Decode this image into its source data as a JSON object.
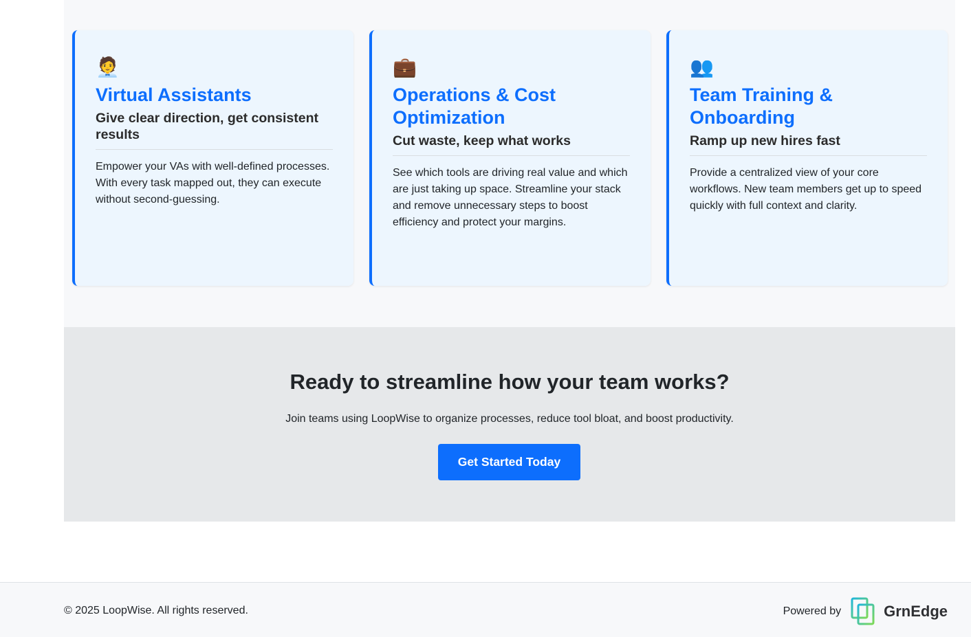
{
  "cards": [
    {
      "icon": "🧑‍💼",
      "title": "Virtual Assistants",
      "subtitle": "Give clear direction, get consistent results",
      "body": "Empower your VAs with well-defined processes. With every task mapped out, they can execute without second-guessing."
    },
    {
      "icon": "💼",
      "title": "Operations & Cost Optimization",
      "subtitle": "Cut waste, keep what works",
      "body": "See which tools are driving real value and which are just taking up space. Streamline your stack and remove unnecessary steps to boost efficiency and protect your margins."
    },
    {
      "icon": "👥",
      "title": "Team Training & Onboarding",
      "subtitle": "Ramp up new hires fast",
      "body": "Provide a centralized view of your core workflows. New team members get up to speed quickly with full context and clarity."
    }
  ],
  "cta": {
    "title": "Ready to streamline how your team works?",
    "text": "Join teams using LoopWise to organize processes, reduce tool bloat, and boost productivity.",
    "button_label": "Get Started Today"
  },
  "footer": {
    "copyright": "© 2025 LoopWise. All rights reserved.",
    "powered_by": "Powered by",
    "brand": "GrnEdge"
  },
  "colors": {
    "accent": "#0d6efd",
    "card_bg": "#edf6fe",
    "cta_bg": "#e6e8ea",
    "brand_gradient_start": "#1fb6d9",
    "brand_gradient_end": "#7ed957"
  },
  "icons": {
    "card_1": "office-worker-icon",
    "card_2": "briefcase-icon",
    "card_3": "people-icon",
    "brand": "grnedge-logo-icon"
  }
}
